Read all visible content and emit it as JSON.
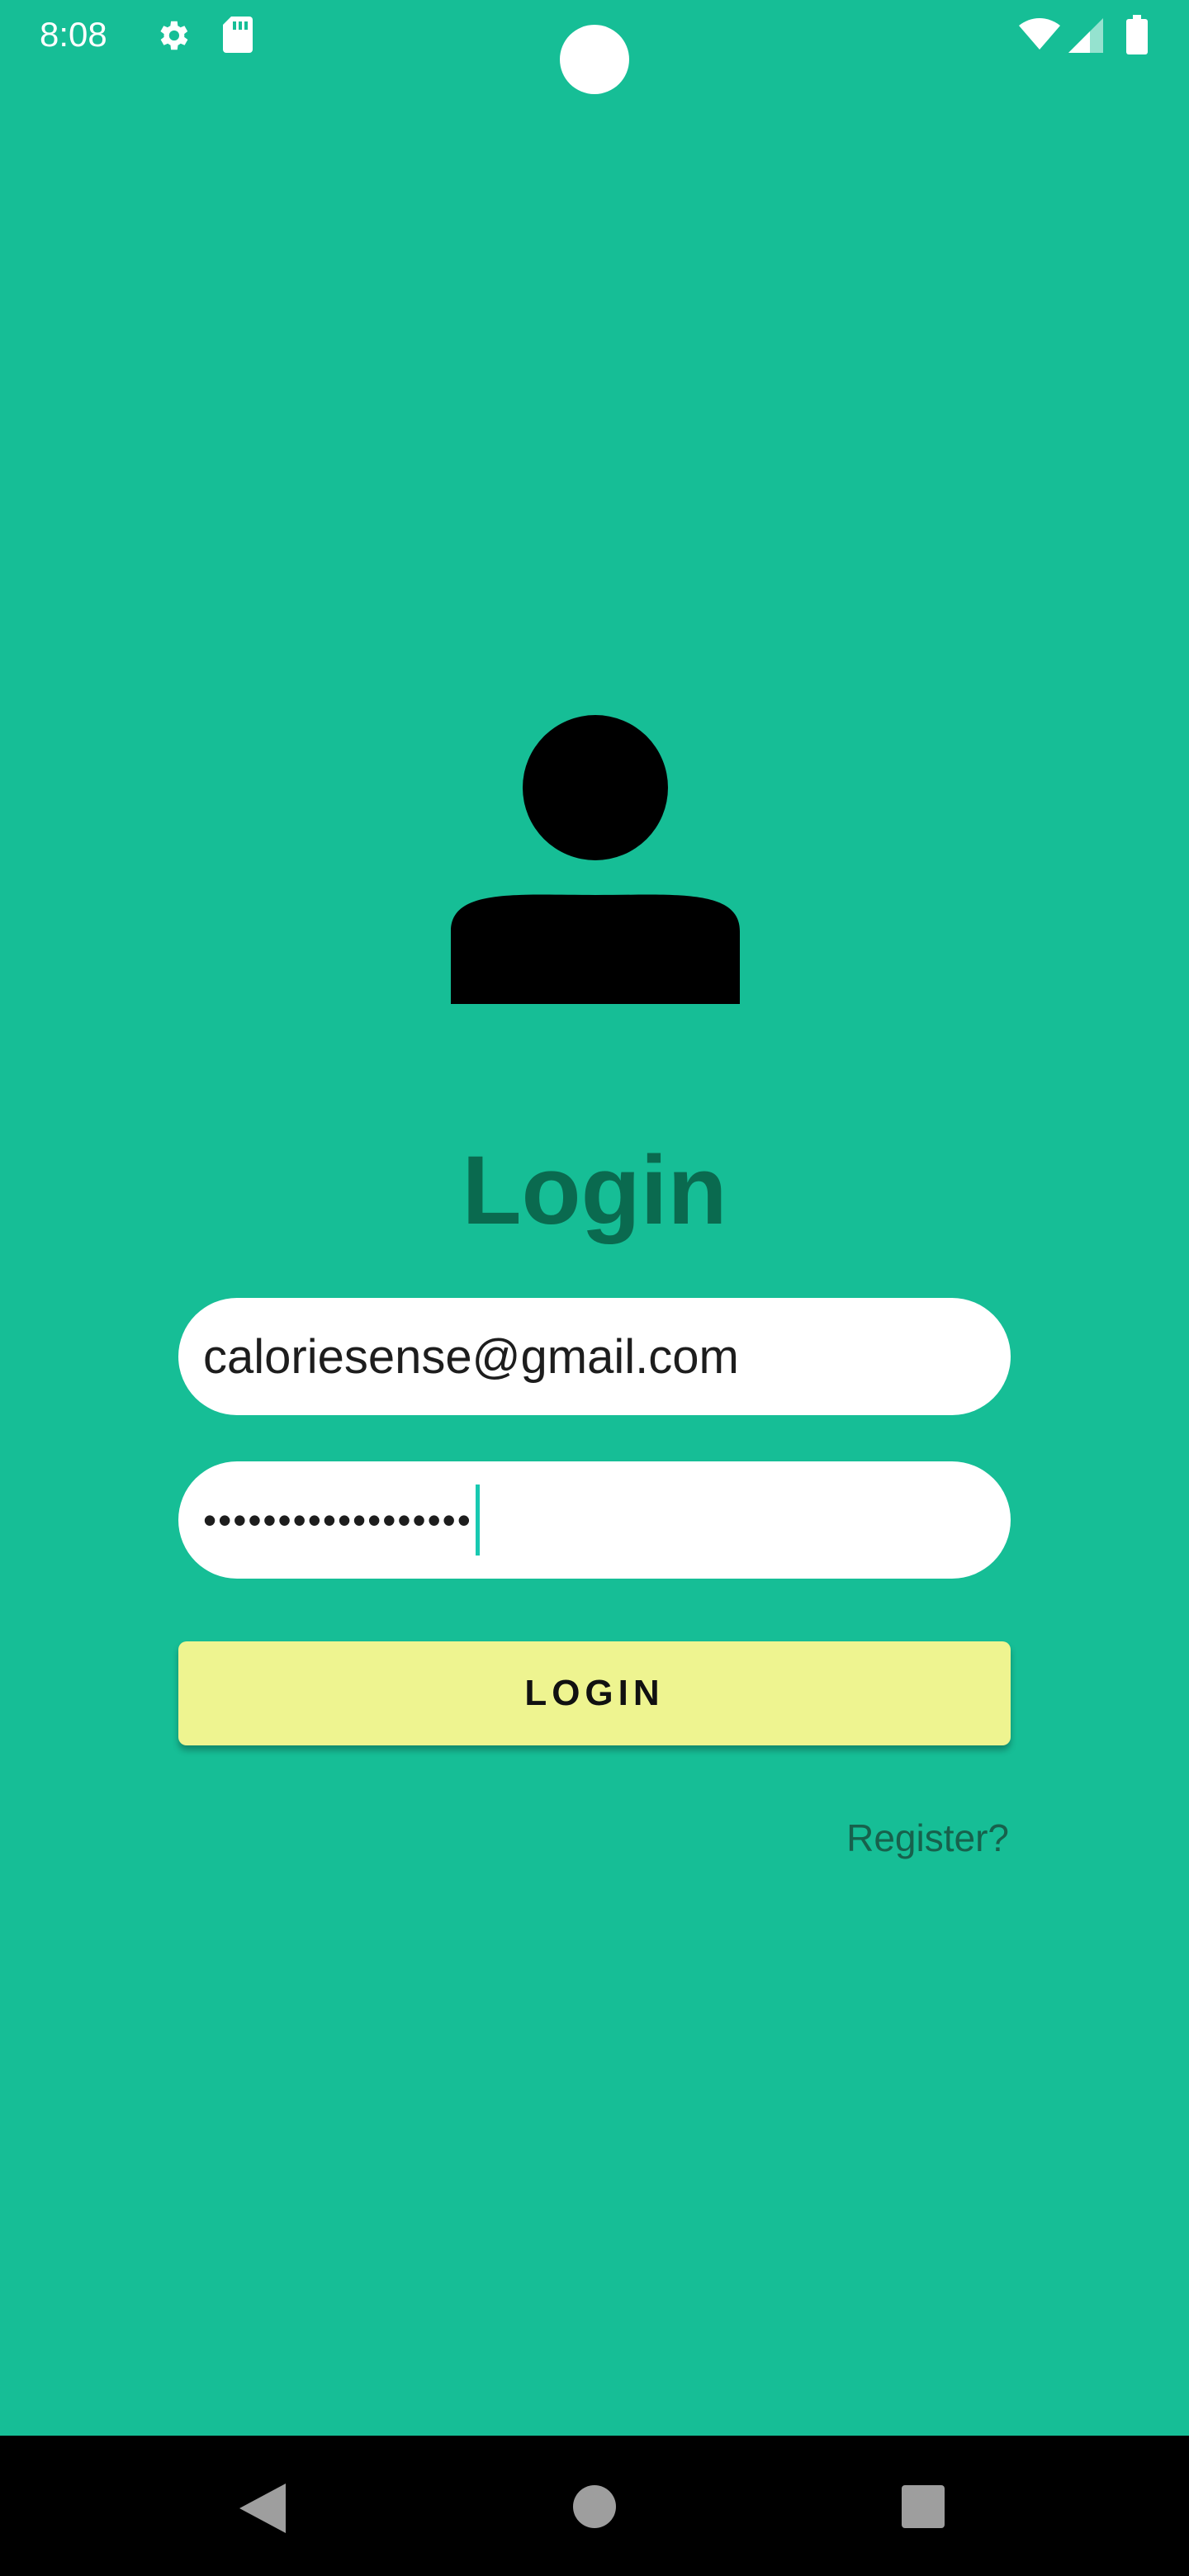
{
  "status_bar": {
    "time": "8:08",
    "icons": [
      "gear-icon",
      "sd-card-icon",
      "wifi-icon",
      "signal-icon",
      "battery-icon"
    ]
  },
  "login": {
    "title": "Login",
    "email_value": "caloriesense@gmail.com",
    "password_value": "••••••••••••••••••",
    "button_label": "LOGIN",
    "register_link": "Register?"
  },
  "colors": {
    "background": "#16be96",
    "title": "#0a6a4f",
    "button": "#eef490",
    "link": "#17614c",
    "caret": "#18c9b1"
  },
  "nav_bar": {
    "icons": [
      "back-icon",
      "home-icon",
      "recents-icon"
    ]
  }
}
